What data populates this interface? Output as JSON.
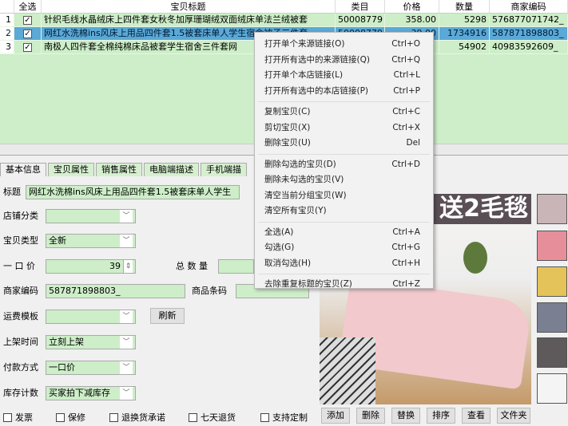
{
  "grid": {
    "columns": [
      "",
      "全选",
      "宝贝标题",
      "类目",
      "价格",
      "数量",
      "商家编码"
    ],
    "rows": [
      {
        "n": "1",
        "checked": true,
        "title": "针织毛线水晶绒床上四件套女秋冬加厚珊瑚绒双面绒床单法兰绒被套",
        "category": "50008779",
        "price": "358.00",
        "qty": "5298",
        "code": "576877071742_"
      },
      {
        "n": "2",
        "checked": true,
        "title": "网红水洗棉ins风床上用品四件套1.5被套床单人学生宿舍被子三件套",
        "category": "50008779",
        "price": "39.00",
        "qty": "1734916",
        "code": "587871898803_"
      },
      {
        "n": "3",
        "checked": true,
        "title": "南极人四件套全棉纯棉床品被套学生宿舍三件套网",
        "category": "",
        "price": "",
        "qty": "54902",
        "code": "40983592609_"
      }
    ]
  },
  "tabs": [
    "基本信息",
    "宝贝属性",
    "销售属性",
    "电脑端描述",
    "手机端描"
  ],
  "form": {
    "title_label": "标题",
    "title_value": "网红水洗棉ins风床上用品四件套1.5被套床单人学生",
    "shop_category_label": "店铺分类",
    "shop_category_value": "",
    "item_type_label": "宝贝类型",
    "item_type_value": "全新",
    "price_label": "一 口 价",
    "price_value": "39",
    "total_qty_label": "总 数 量",
    "total_qty_value": "",
    "merchant_code_label": "商家编码",
    "merchant_code_value": "587871898803_",
    "barcode_label": "商品条码",
    "barcode_value": "",
    "shipping_label": "运费模板",
    "shipping_value": "",
    "refresh_label": "刷新",
    "listing_time_label": "上架时间",
    "listing_time_value": "立刻上架",
    "payment_label": "付款方式",
    "payment_value": "一口价",
    "stock_label": "库存计数",
    "stock_value": "买家拍下减库存"
  },
  "checkboxes": [
    {
      "label": "发票",
      "checked": false
    },
    {
      "label": "保修",
      "checked": false
    },
    {
      "label": "退换货承诺",
      "checked": false
    },
    {
      "label": "七天退货",
      "checked": false
    },
    {
      "label": "支持定制",
      "checked": false
    }
  ],
  "image": {
    "banner_text": "送2毛毯"
  },
  "image_buttons": [
    "添加",
    "删除",
    "替换",
    "排序",
    "查看",
    "文件夹"
  ],
  "menu": [
    [
      {
        "label": "打开单个来源链接(O)",
        "shortcut": "Ctrl+O"
      },
      {
        "label": "打开所有选中的来源链接(Q)",
        "shortcut": "Ctrl+Q"
      },
      {
        "label": "打开单个本店链接(L)",
        "shortcut": "Ctrl+L"
      },
      {
        "label": "打开所有选中的本店链接(P)",
        "shortcut": "Ctrl+P"
      }
    ],
    [
      {
        "label": "复制宝贝(C)",
        "shortcut": "Ctrl+C"
      },
      {
        "label": "剪切宝贝(X)",
        "shortcut": "Ctrl+X"
      },
      {
        "label": "删除宝贝(U)",
        "shortcut": "Del"
      }
    ],
    [
      {
        "label": "删除勾选的宝贝(D)",
        "shortcut": "Ctrl+D"
      },
      {
        "label": "删除未勾选的宝贝(V)",
        "shortcut": ""
      },
      {
        "label": "清空当前分组宝贝(W)",
        "shortcut": ""
      },
      {
        "label": "清空所有宝贝(Y)",
        "shortcut": ""
      }
    ],
    [
      {
        "label": "全选(A)",
        "shortcut": "Ctrl+A"
      },
      {
        "label": "勾选(G)",
        "shortcut": "Ctrl+G"
      },
      {
        "label": "取消勾选(H)",
        "shortcut": "Ctrl+H"
      }
    ],
    [
      {
        "label": "去除重复标题的宝贝(Z)",
        "shortcut": "Ctrl+Z"
      }
    ]
  ]
}
